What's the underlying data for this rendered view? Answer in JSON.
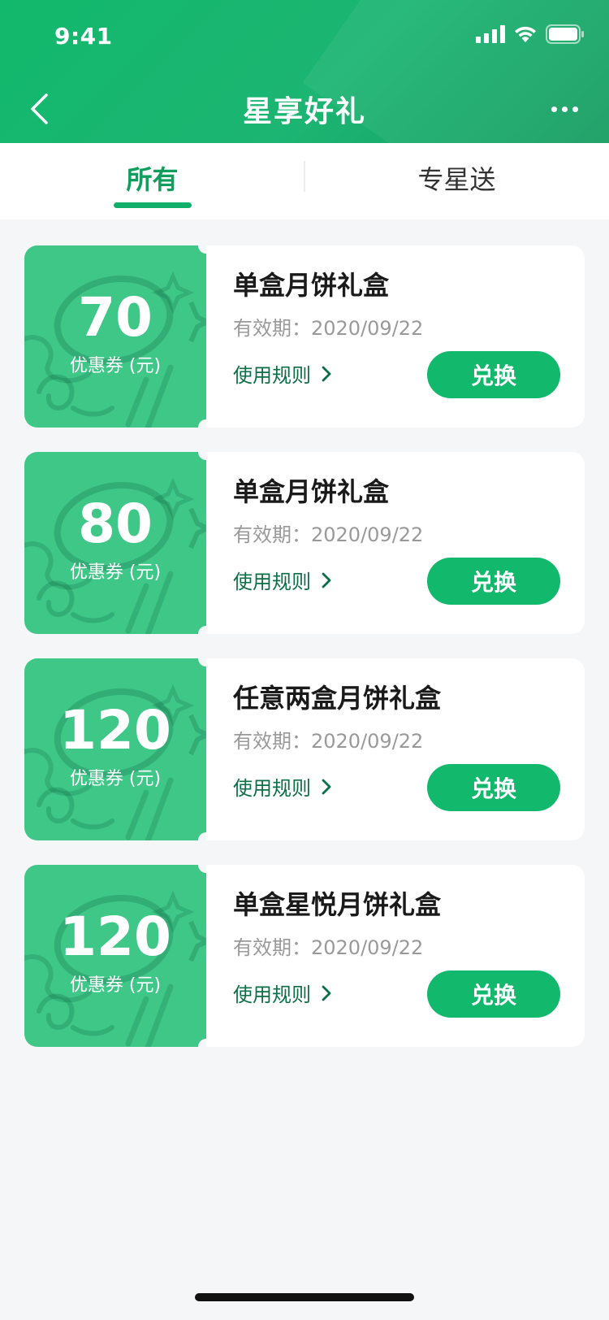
{
  "status_bar": {
    "time": "9:41"
  },
  "navbar": {
    "title": "星享好礼"
  },
  "tabs": [
    {
      "label": "所有",
      "active": true
    },
    {
      "label": "专星送",
      "active": false
    }
  ],
  "coupons": [
    {
      "amount": "70",
      "unit": "优惠券 (元)",
      "name": "单盒月饼礼盒",
      "validity": "有效期：2020/09/22",
      "rules_label": "使用规则",
      "redeem_label": "兑换"
    },
    {
      "amount": "80",
      "unit": "优惠券 (元)",
      "name": "单盒月饼礼盒",
      "validity": "有效期：2020/09/22",
      "rules_label": "使用规则",
      "redeem_label": "兑换"
    },
    {
      "amount": "120",
      "unit": "优惠券 (元)",
      "name": "任意两盒月饼礼盒",
      "validity": "有效期：2020/09/22",
      "rules_label": "使用规则",
      "redeem_label": "兑换"
    },
    {
      "amount": "120",
      "unit": "优惠券 (元)",
      "name": "单盒星悦月饼礼盒",
      "validity": "有效期：2020/09/22",
      "rules_label": "使用规则",
      "redeem_label": "兑换"
    }
  ],
  "colors": {
    "brand_green": "#12b86c",
    "coupon_green": "#3fc788",
    "link_green": "#0c6f45",
    "background": "#f5f6f7"
  }
}
